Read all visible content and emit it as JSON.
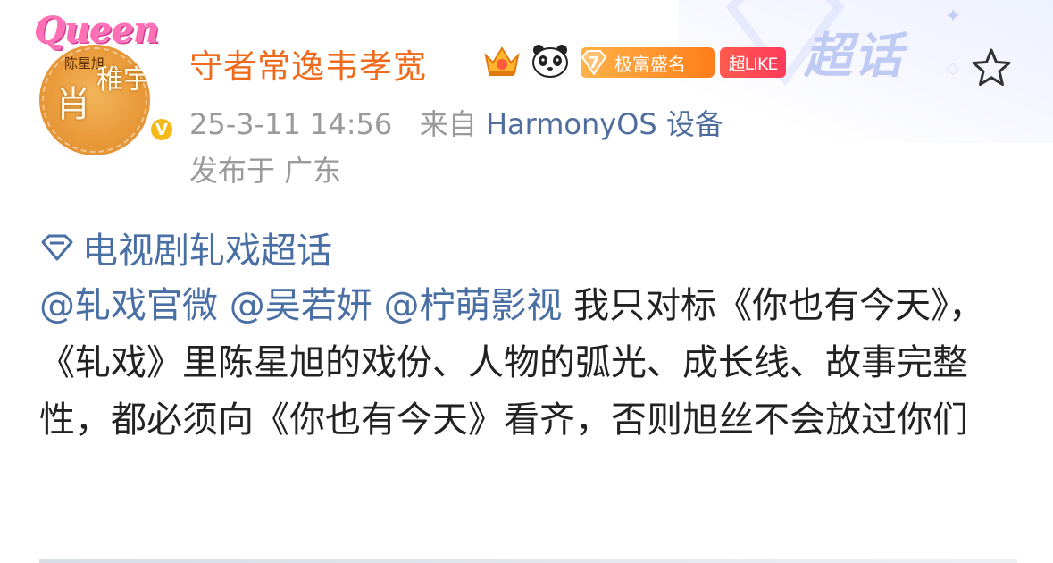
{
  "header": {
    "avatar": {
      "frame_text": "Queen",
      "name_small": "陈星旭",
      "name_large_1": "肖",
      "name_large_2": "稚宇",
      "verified_mark": "V"
    },
    "username": "守者常逸韦孝宽",
    "badges": {
      "level_number": "7",
      "level_text": "极富盛名",
      "super_like": "超LIKE"
    },
    "supertopic_logo": "超话",
    "favorite_icon": "star-outline-icon"
  },
  "meta": {
    "timestamp": "25-3-11 14:56",
    "source_prefix": "来自",
    "source_device": "HarmonyOS 设备",
    "location": "发布于 广东"
  },
  "post": {
    "topic": "电视剧轧戏超话",
    "mentions": [
      "@轧戏官微",
      "@吴若妍",
      "@柠萌影视"
    ],
    "body": "我只对标《你也有今天》，《轧戏》里陈星旭的戏份、人物的弧光、成长线、故事完整性，都必须向《你也有今天》看齐，否则旭丝不会放过你们"
  },
  "colors": {
    "username": "#f06a1c",
    "link_blue": "#4a6fa5",
    "meta_gray": "#9a9a9a",
    "level_badge": "#ff9a30",
    "like_badge": "#ff4656"
  }
}
